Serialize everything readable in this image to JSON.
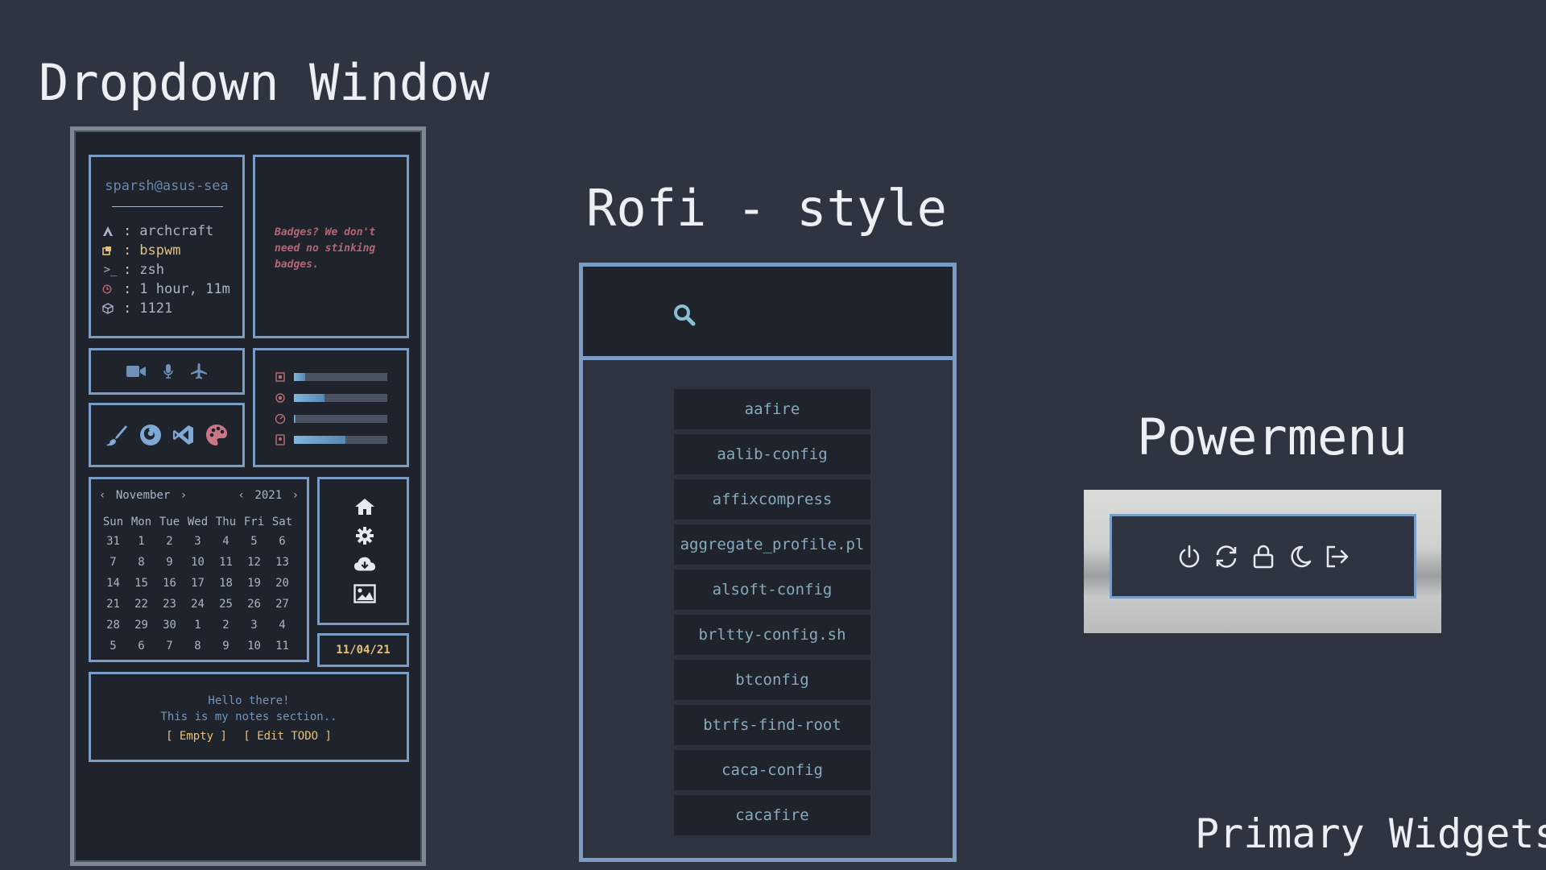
{
  "headings": {
    "dropdown": "Dropdown Window",
    "rofi": "Rofi - style",
    "powermenu": "Powermenu",
    "primary": "Primary Widgets"
  },
  "dropdown": {
    "user": "sparsh@asus-sea",
    "info": [
      {
        "icon": "archlinux-icon",
        "label": "archcraft",
        "color": "#a9b6c6"
      },
      {
        "icon": "window-icon",
        "label": "bspwm",
        "color": "#e6c07b"
      },
      {
        "icon": "terminal-icon",
        "label": "zsh",
        "color": "#a9b6c6"
      },
      {
        "icon": "clock-icon",
        "label": "1 hour, 11m",
        "color": "#a9b6c6"
      },
      {
        "icon": "package-icon",
        "label": "1121",
        "color": "#a9b6c6"
      }
    ],
    "badges_text": "Badges?  We don't need no stinking badges.",
    "toggles": [
      "camera-icon",
      "microphone-icon",
      "airplane-icon"
    ],
    "apps": [
      "brush-icon",
      "firefox-icon",
      "vscode-icon",
      "palette-icon"
    ],
    "system": [
      {
        "icon": "cpu-icon",
        "value": 0.12
      },
      {
        "icon": "memory-icon",
        "value": 0.33
      },
      {
        "icon": "gauge-icon",
        "value": 0.02
      },
      {
        "icon": "disk-icon",
        "value": 0.55
      }
    ],
    "calendar": {
      "month": "November",
      "year": "2021",
      "weekdays": [
        "Sun",
        "Mon",
        "Tue",
        "Wed",
        "Thu",
        "Fri",
        "Sat"
      ],
      "weeks": [
        [
          "31",
          "1",
          "2",
          "3",
          "4",
          "5",
          "6"
        ],
        [
          "7",
          "8",
          "9",
          "10",
          "11",
          "12",
          "13"
        ],
        [
          "14",
          "15",
          "16",
          "17",
          "18",
          "19",
          "20"
        ],
        [
          "21",
          "22",
          "23",
          "24",
          "25",
          "26",
          "27"
        ],
        [
          "28",
          "29",
          "30",
          "1",
          "2",
          "3",
          "4"
        ],
        [
          "5",
          "6",
          "7",
          "8",
          "9",
          "10",
          "11"
        ]
      ]
    },
    "quick": [
      "home-icon",
      "gear-icon",
      "cloud-download-icon",
      "image-icon"
    ],
    "date": "11/04/21",
    "notes": {
      "line1": "Hello there!",
      "line2": "This is my notes section..",
      "empty_label": "[ Empty ]",
      "edit_label": "[ Edit TODO ]"
    }
  },
  "rofi": {
    "search_icon": "search-icon",
    "items": [
      "aafire",
      "aalib-config",
      "affixcompress",
      "aggregate_profile.pl",
      "alsoft-config",
      "brltty-config.sh",
      "btconfig",
      "btrfs-find-root",
      "caca-config",
      "cacafire"
    ]
  },
  "powermenu": {
    "buttons": [
      "power-icon",
      "restart-icon",
      "lock-icon",
      "sleep-icon",
      "logout-icon"
    ]
  },
  "colors": {
    "background": "#2e3440",
    "panel": "#1f232c",
    "accent": "#7b9cc4",
    "yellow": "#e6c07b",
    "red": "#b56775"
  }
}
